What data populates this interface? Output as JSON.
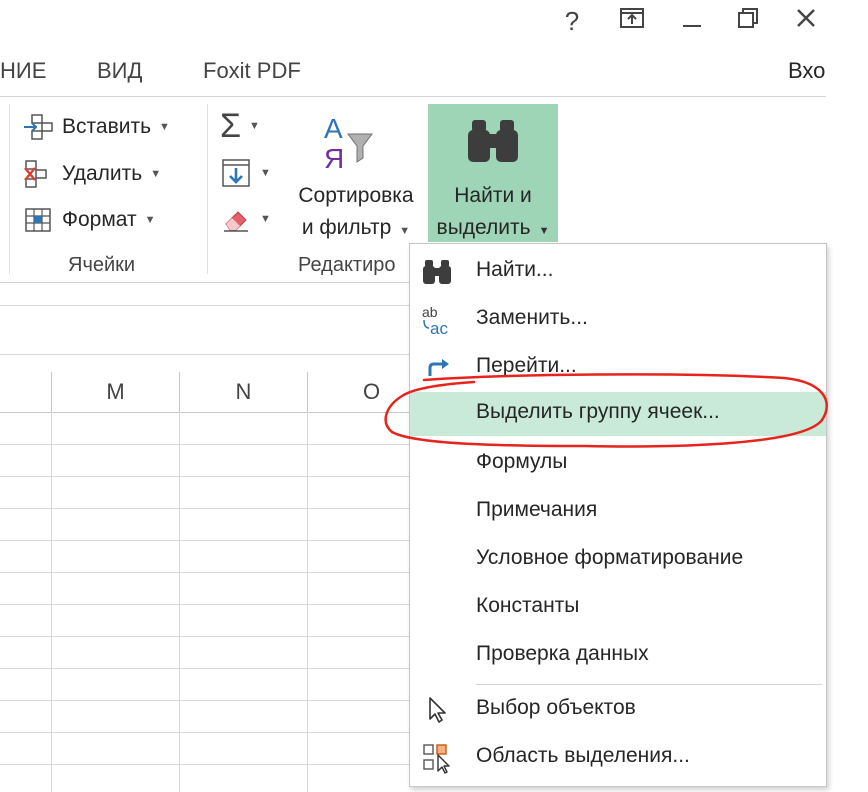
{
  "window": {
    "help": "?",
    "ribbon_display": "⊼",
    "minimize": "—",
    "restore": "❐",
    "close": "✕",
    "signin": "Вхо"
  },
  "tabs": [
    "НИЕ",
    "ВИД",
    "Foxit PDF"
  ],
  "ribbon": {
    "cells_group": {
      "insert": "Вставить",
      "delete": "Удалить",
      "format": "Формат",
      "label": "Ячейки"
    },
    "editing_group": {
      "sort_line1": "Сортировка",
      "sort_line2": "и фильтр",
      "find_line1": "Найти и",
      "find_line2": "выделить",
      "label": "Редактиро"
    }
  },
  "grid": {
    "columns": [
      "M",
      "N",
      "O"
    ]
  },
  "menu": {
    "items": [
      {
        "label": "Найти...",
        "icon": "binoculars-icon"
      },
      {
        "label": "Заменить...",
        "icon": "replace-icon"
      },
      {
        "label": "Перейти...",
        "icon": "goto-arrow-icon"
      },
      {
        "label": "Выделить группу ячеек...",
        "icon": ""
      },
      {
        "label": "Формулы",
        "icon": ""
      },
      {
        "label": "Примечания",
        "icon": ""
      },
      {
        "label": "Условное форматирование",
        "icon": ""
      },
      {
        "label": "Константы",
        "icon": ""
      },
      {
        "label": "Проверка данных",
        "icon": ""
      },
      {
        "label": "Выбор объектов",
        "icon": "cursor-icon"
      },
      {
        "label": "Область выделения...",
        "icon": "selection-pane-icon"
      }
    ],
    "highlight_color": "#c9ead8",
    "annotation_color": "#e8231c"
  }
}
